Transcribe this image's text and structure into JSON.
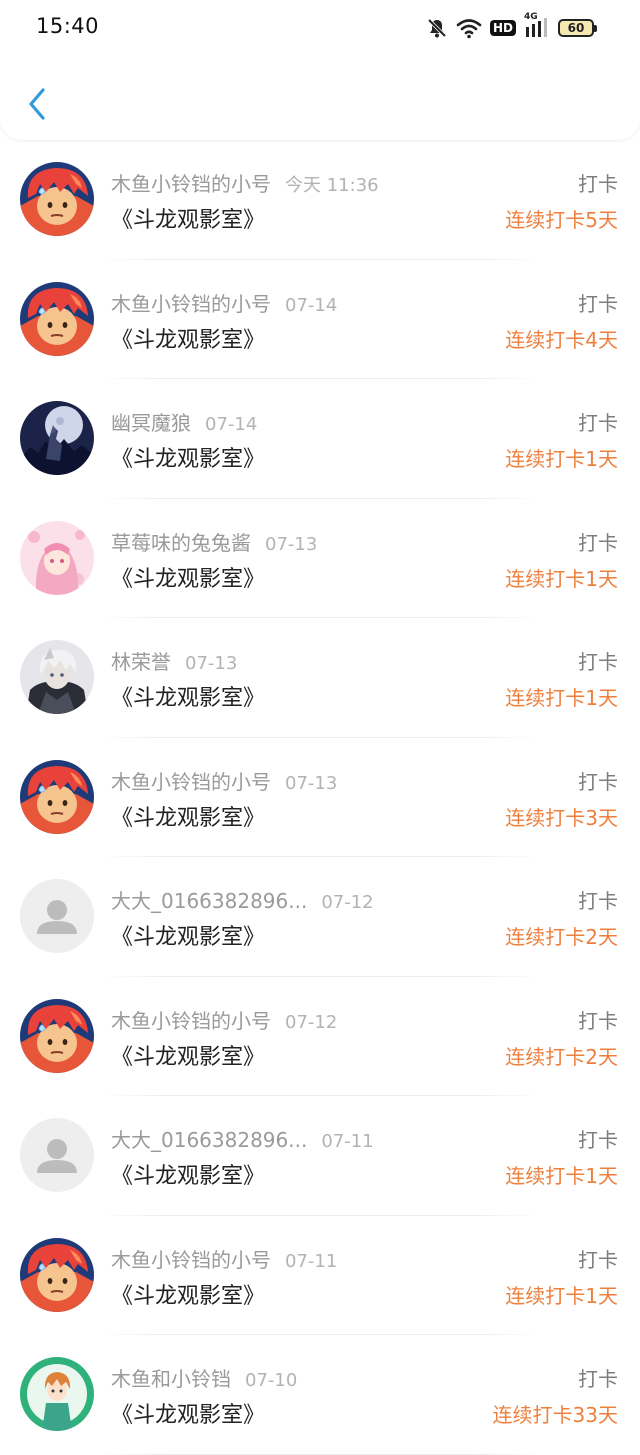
{
  "status_bar": {
    "time": "15:40",
    "icons": [
      "bell-muted-icon",
      "wifi-icon",
      "hd-icon",
      "signal-4g-icon",
      "battery-icon"
    ],
    "hd_label": "HD",
    "network_label": "4G",
    "battery_level": "60"
  },
  "header": {
    "back_icon": "chevron-left-icon"
  },
  "colors": {
    "accent": "#2e9bdc",
    "streak": "#ef7f3c"
  },
  "records": [
    {
      "avatar": "orange-hair",
      "name": "木鱼小铃铛的小号",
      "date": "今天 11:36",
      "title": "《斗龙观影室》",
      "action": "打卡",
      "streak": "连续打卡5天"
    },
    {
      "avatar": "orange-hair",
      "name": "木鱼小铃铛的小号",
      "date": "07-14",
      "title": "《斗龙观影室》",
      "action": "打卡",
      "streak": "连续打卡4天"
    },
    {
      "avatar": "wolf-moon",
      "name": "幽冥魔狼",
      "date": "07-14",
      "title": "《斗龙观影室》",
      "action": "打卡",
      "streak": "连续打卡1天"
    },
    {
      "avatar": "pink-girl",
      "name": "草莓味的兔兔酱",
      "date": "07-13",
      "title": "《斗龙观影室》",
      "action": "打卡",
      "streak": "连续打卡1天"
    },
    {
      "avatar": "dark-boy",
      "name": "林荣誉",
      "date": "07-13",
      "title": "《斗龙观影室》",
      "action": "打卡",
      "streak": "连续打卡1天"
    },
    {
      "avatar": "orange-hair",
      "name": "木鱼小铃铛的小号",
      "date": "07-13",
      "title": "《斗龙观影室》",
      "action": "打卡",
      "streak": "连续打卡3天"
    },
    {
      "avatar": "default",
      "name": "大大_0166382896...",
      "date": "07-12",
      "title": "《斗龙观影室》",
      "action": "打卡",
      "streak": "连续打卡2天"
    },
    {
      "avatar": "orange-hair",
      "name": "木鱼小铃铛的小号",
      "date": "07-12",
      "title": "《斗龙观影室》",
      "action": "打卡",
      "streak": "连续打卡2天"
    },
    {
      "avatar": "default",
      "name": "大大_0166382896...",
      "date": "07-11",
      "title": "《斗龙观影室》",
      "action": "打卡",
      "streak": "连续打卡1天"
    },
    {
      "avatar": "orange-hair",
      "name": "木鱼小铃铛的小号",
      "date": "07-11",
      "title": "《斗龙观影室》",
      "action": "打卡",
      "streak": "连续打卡1天"
    },
    {
      "avatar": "anime-green",
      "name": "木鱼和小铃铛",
      "date": "07-10",
      "title": "《斗龙观影室》",
      "action": "打卡",
      "streak": "连续打卡33天"
    }
  ]
}
